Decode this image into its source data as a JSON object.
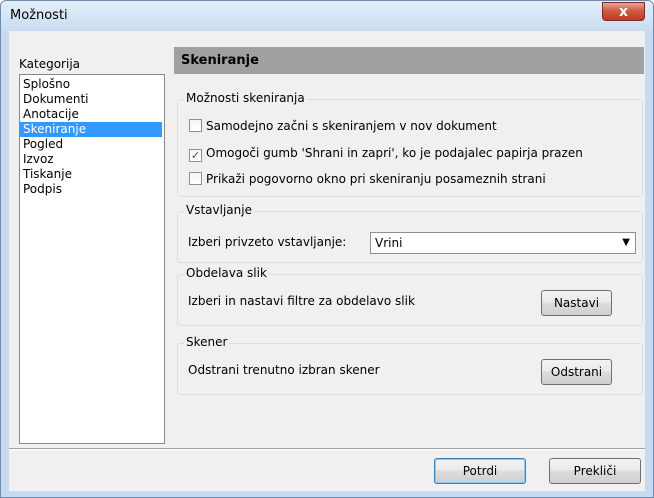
{
  "window": {
    "title": "Možnosti",
    "close_label": "x"
  },
  "categories": {
    "label": "Kategorija",
    "items": [
      "Splošno",
      "Dokumenti",
      "Anotacije",
      "Skeniranje",
      "Pogled",
      "Izvoz",
      "Tiskanje",
      "Podpis"
    ],
    "selected": "Skeniranje"
  },
  "panel": {
    "title": "Skeniranje",
    "scan_options": {
      "title": "Možnosti skeniranja",
      "options": [
        {
          "label": "Samodejno začni s skeniranjem v nov dokument",
          "checked": false
        },
        {
          "label": "Omogoči gumb 'Shrani in zapri', ko je podajalec papirja prazen",
          "checked": true
        },
        {
          "label": "Prikaži pogovorno okno pri skeniranju posameznih strani",
          "checked": false
        }
      ]
    },
    "insert": {
      "title": "Vstavljanje",
      "label": "Izberi privzeto vstavljanje:",
      "value": "Vrini"
    },
    "image_processing": {
      "title": "Obdelava slik",
      "label": "Izberi in nastavi filtre za obdelavo slik",
      "button": "Nastavi"
    },
    "scanner": {
      "title": "Skener",
      "label": "Odstrani trenutno izbran skener",
      "button": "Odstrani"
    }
  },
  "footer": {
    "ok": "Potrdi",
    "cancel": "Prekliči"
  }
}
